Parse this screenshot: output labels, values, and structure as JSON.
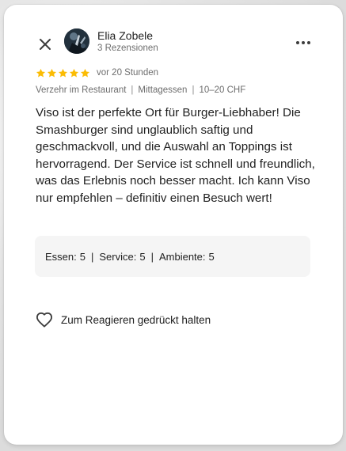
{
  "author": {
    "name": "Elia Zobele",
    "reviews": "3 Rezensionen"
  },
  "rating": {
    "stars": 5,
    "max": 5,
    "star_color": "#fbbc04",
    "time_ago": "vor 20 Stunden"
  },
  "meta": {
    "visit_type": "Verzehr im Restaurant",
    "meal": "Mittagessen",
    "price": "10–20 CHF"
  },
  "review_text": "Viso ist der perfekte Ort für Burger-Liebhaber! Die Smashburger sind unglaublich saftig und geschmackvoll, und die Auswahl an Toppings ist hervorragend. Der Service ist schnell und freundlich, was das Erlebnis noch besser macht. Ich kann Viso nur empfehlen – definitiv einen Besuch wert!",
  "scores": {
    "food_label": "Essen:",
    "food_value": "5",
    "service_label": "Service:",
    "service_value": "5",
    "ambience_label": "Ambiente:",
    "ambience_value": "5"
  },
  "react": {
    "label": "Zum Reagieren gedrückt halten"
  },
  "icons": {
    "close": "close-icon",
    "more": "more-vertical-icon",
    "star": "star-icon",
    "heart": "heart-outline-icon"
  }
}
